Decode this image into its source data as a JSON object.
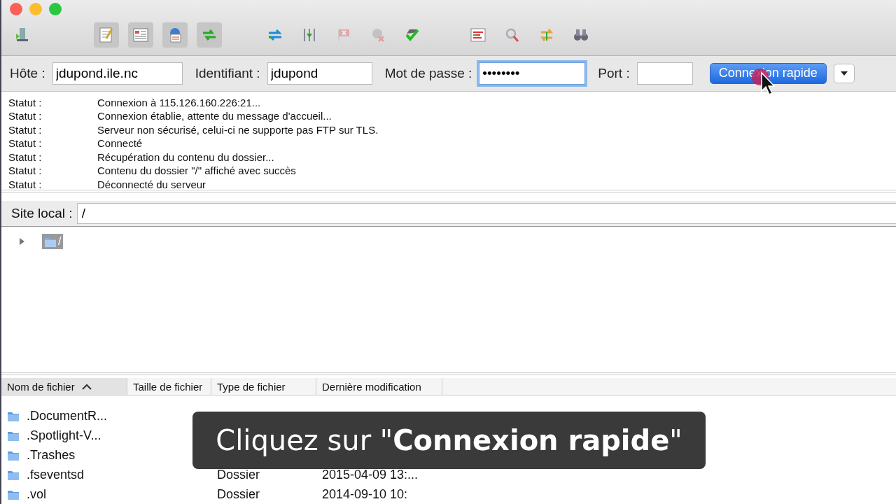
{
  "window": {
    "controls": [
      {
        "kind": "close"
      },
      {
        "kind": "minimize"
      },
      {
        "kind": "zoom"
      }
    ]
  },
  "toolbar": {
    "groups": [
      [
        {
          "pressed": false,
          "disabled": false
        }
      ],
      [
        {
          "pressed": true,
          "disabled": false
        },
        {
          "pressed": true,
          "disabled": false
        },
        {
          "pressed": true,
          "disabled": false
        },
        {
          "pressed": true,
          "disabled": false
        }
      ],
      [
        {
          "pressed": false,
          "disabled": false
        },
        {
          "pressed": false,
          "disabled": false
        },
        {
          "pressed": false,
          "disabled": true
        },
        {
          "pressed": false,
          "disabled": true
        },
        {
          "pressed": false,
          "disabled": false
        }
      ],
      [
        {
          "pressed": false,
          "disabled": false
        },
        {
          "pressed": false,
          "disabled": false
        },
        {
          "pressed": false,
          "disabled": false
        },
        {
          "pressed": false,
          "disabled": false
        }
      ]
    ]
  },
  "quickconnect": {
    "fields": [
      {
        "label": "Hôte :",
        "value": "jdupond.ile.nc",
        "focused": false
      },
      {
        "label": "Identifiant :",
        "value": "jdupond",
        "focused": false
      },
      {
        "label": "Mot de passe :",
        "value": "••••••••",
        "focused": true
      },
      {
        "label": "Port :",
        "focused": false
      }
    ],
    "button": "Connexion rapide"
  },
  "log": [
    {
      "label": "Statut :",
      "message": "Connexion à 115.126.160.226:21..."
    },
    {
      "label": "Statut :",
      "message": "Connexion établie, attente du message d'accueil..."
    },
    {
      "label": "Statut :",
      "message": "Serveur non sécurisé, celui-ci ne supporte pas FTP sur TLS."
    },
    {
      "label": "Statut :",
      "message": "Connecté"
    },
    {
      "label": "Statut :",
      "message": "Récupération du contenu du dossier..."
    },
    {
      "label": "Statut :",
      "message": "Contenu du dossier \"/\" affiché avec succès"
    },
    {
      "label": "Statut :",
      "message": "Déconnecté du serveur"
    }
  ],
  "local_site": {
    "label": "Site local :",
    "path": "/"
  },
  "tree": [
    {
      "label": "/",
      "expanded": false,
      "selected": true
    }
  ],
  "table": {
    "columns": [
      {
        "label": "Nom de fichier",
        "sorted": true
      },
      {
        "label": "Taille de fichier",
        "sorted": false
      },
      {
        "label": "Type de fichier",
        "sorted": false
      },
      {
        "label": "Dernière modification",
        "sorted": false
      }
    ],
    "rows": [
      {
        "name": ".DocumentR..."
      },
      {
        "name": ".Spotlight-V..."
      },
      {
        "name": ".Trashes"
      },
      {
        "name": ".fseventsd",
        "type": "Dossier",
        "modified": "2015-04-09 13:..."
      },
      {
        "name": ".vol",
        "type": "Dossier",
        "modified": "2014-09-10 10:"
      }
    ]
  },
  "caption": {
    "text": "Cliquez sur \"**Connexion rapide**\""
  }
}
